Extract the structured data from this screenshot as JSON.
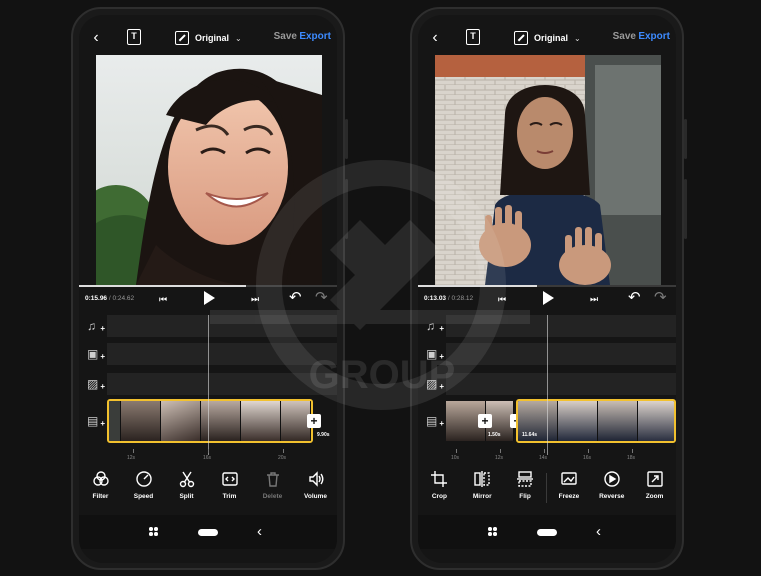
{
  "watermark": {
    "text": "GROUP"
  },
  "phones": [
    {
      "topbar": {
        "ratio_label": "Original",
        "save_label": "Save",
        "export_label": "Export"
      },
      "playback": {
        "current_time": "0:15.96",
        "total_time": "/ 0:24.62",
        "progress": 0.648
      },
      "clips": [
        {
          "duration": "9.90s"
        }
      ],
      "ruler": [
        "12s",
        "16s",
        "20s"
      ],
      "tools": [
        {
          "name": "filter",
          "label": "Filter",
          "icon": "filter-icon",
          "enabled": true
        },
        {
          "name": "speed",
          "label": "Speed",
          "icon": "speedometer-icon",
          "enabled": true
        },
        {
          "name": "split",
          "label": "Split",
          "icon": "scissors-icon",
          "enabled": true
        },
        {
          "name": "trim",
          "label": "Trim",
          "icon": "trim-icon",
          "enabled": true
        },
        {
          "name": "delete",
          "label": "Delete",
          "icon": "trash-icon",
          "enabled": false
        },
        {
          "name": "volume",
          "label": "Volume",
          "icon": "volume-icon",
          "enabled": true
        }
      ]
    },
    {
      "topbar": {
        "ratio_label": "Original",
        "save_label": "Save",
        "export_label": "Export"
      },
      "playback": {
        "current_time": "0:13.03",
        "total_time": "/ 0:28.12",
        "progress": 0.463
      },
      "clips": [
        {
          "duration": "1.50s"
        },
        {
          "duration": "11.64s"
        }
      ],
      "ruler": [
        "10s",
        "12s",
        "14s",
        "16s",
        "18s"
      ],
      "tools": [
        {
          "name": "crop",
          "label": "Crop",
          "icon": "crop-icon",
          "enabled": true
        },
        {
          "name": "mirror",
          "label": "Mirror",
          "icon": "mirror-icon",
          "enabled": true
        },
        {
          "name": "flip",
          "label": "Flip",
          "icon": "flip-icon",
          "enabled": true
        },
        {
          "name": "freeze",
          "label": "Freeze",
          "icon": "freeze-frame-icon",
          "enabled": true
        },
        {
          "name": "reverse",
          "label": "Reverse",
          "icon": "reverse-icon",
          "enabled": true
        },
        {
          "name": "zoom",
          "label": "Zoom",
          "icon": "zoom-icon",
          "enabled": true
        }
      ]
    }
  ],
  "colors": {
    "accent": "#3d8bff",
    "clip_border": "#f2c12e",
    "background": "#121212",
    "track": "#232323"
  }
}
